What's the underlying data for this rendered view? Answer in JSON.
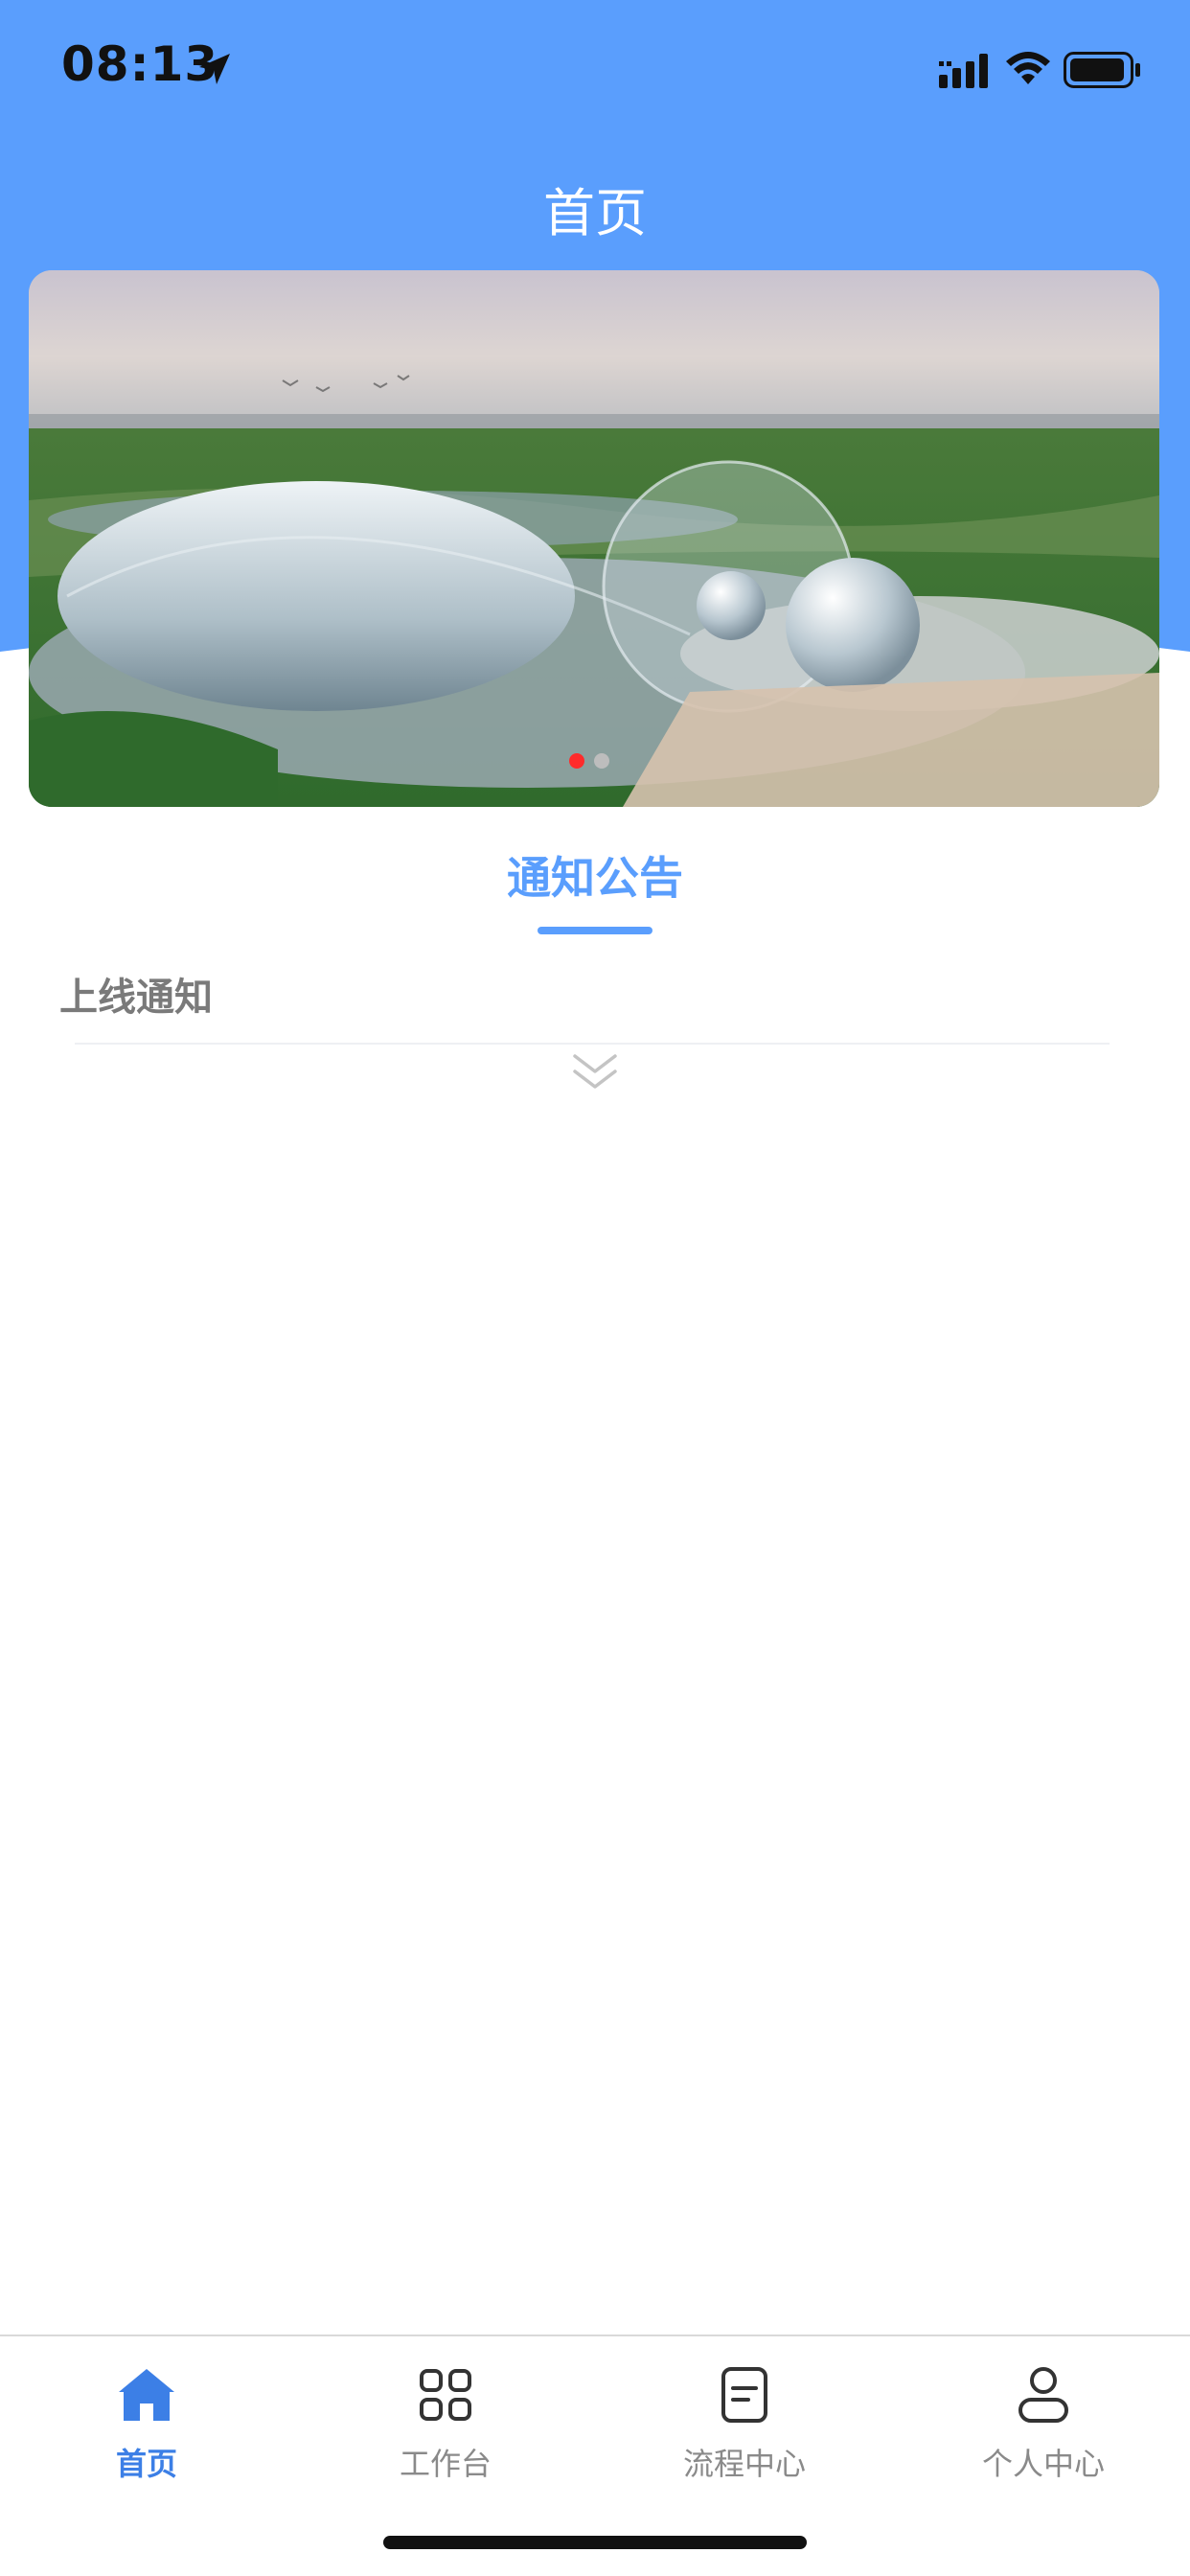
{
  "status_bar": {
    "time": "08:13"
  },
  "header": {
    "title": "首页"
  },
  "banner": {
    "image_subject": "aerial view of a futuristic glass-domed building complex beside water and green park",
    "dots": [
      {
        "active": true,
        "color": "#ff2b2b"
      },
      {
        "active": false,
        "color": "#bdbdbd"
      }
    ]
  },
  "notice": {
    "tab_label": "通知公告",
    "items": [
      {
        "title": "上线通知"
      }
    ],
    "expand_icon": "chevron-double-down-icon"
  },
  "tabbar": {
    "items": [
      {
        "label": "首页",
        "icon": "home-icon",
        "active": true
      },
      {
        "label": "工作台",
        "icon": "grid-icon",
        "active": false
      },
      {
        "label": "流程中心",
        "icon": "document-icon",
        "active": false
      },
      {
        "label": "个人中心",
        "icon": "user-icon",
        "active": false
      }
    ]
  },
  "colors": {
    "primary": "#5a9efd",
    "tab_active": "#3c7fe6",
    "tab_inactive": "#8a8a8a",
    "notice_text": "#7a7a7a"
  }
}
